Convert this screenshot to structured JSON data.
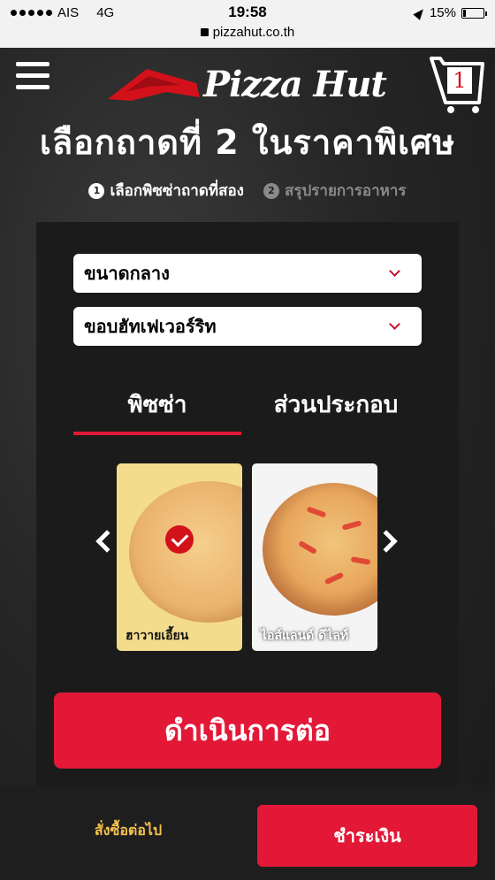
{
  "status_bar": {
    "carrier": "AIS",
    "network": "4G",
    "time": "19:58",
    "url": "pizzahut.co.th",
    "battery": "15%",
    "battery_level": 0.15
  },
  "header": {
    "brand": "Pizza Hut",
    "cart_count": "1",
    "icons": [
      "hamburger-menu-icon",
      "pizza-hut-roof-logo",
      "cart-icon"
    ]
  },
  "page": {
    "title": "เลือกถาดที่ 2 ในราคาพิเศษ"
  },
  "steps": [
    {
      "num": "1",
      "label": "เลือกพิซซ่าถาดที่สอง"
    },
    {
      "num": "2",
      "label": "สรุปรายการอาหาร"
    }
  ],
  "selectors": {
    "size": "ขนาดกลาง",
    "crust": "ขอบฮัทเฟเวอร์ริท"
  },
  "tabs": [
    {
      "label": "พิซซ่า"
    },
    {
      "label": "ส่วนประกอบ"
    }
  ],
  "pizzas": [
    {
      "name": "ฮาวายเอี้ยน",
      "selected": true
    },
    {
      "name": "ไอส์แลนด์ ดีไลท์",
      "selected": false
    }
  ],
  "actions": {
    "continue": "ดำเนินการต่อ",
    "continue_shopping": "สั่งซื้อต่อไป",
    "checkout": "ชำระเงิน"
  },
  "colors": {
    "brand_red": "#e31837",
    "accent_yellow": "#f5c24c"
  }
}
